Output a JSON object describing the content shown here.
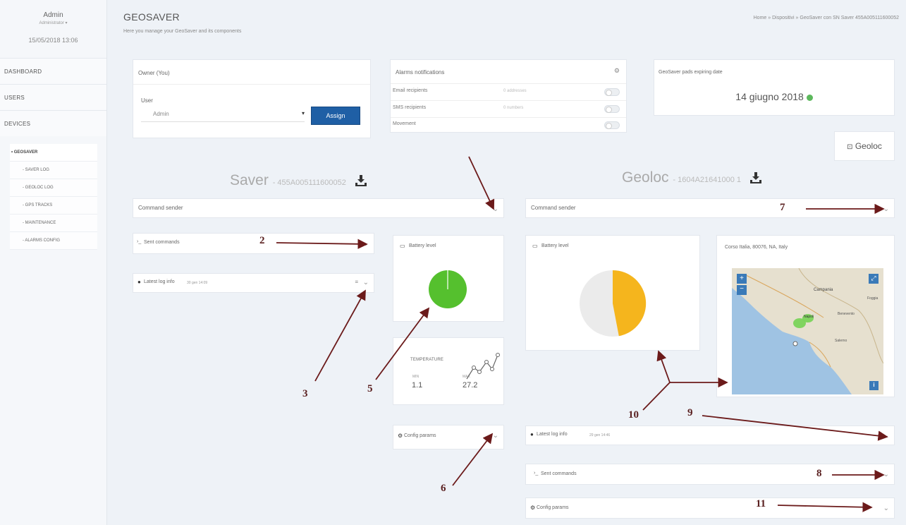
{
  "sidebar": {
    "user_name": "Admin",
    "user_role": "Administrator",
    "date": "15/05/2018 13:06",
    "main_items": [
      "DASHBOARD",
      "USERS",
      "DEVICES"
    ],
    "sub_items": [
      "• GEOSAVER",
      "- SAVER LOG",
      "- GEOLOC LOG",
      "- GPS TRACKS",
      "- MAINTENANCE",
      "- ALARMS CONFIG"
    ]
  },
  "header": {
    "title": "GEOSAVER",
    "subtitle": "Here you manage your GeoSaver and its components",
    "breadcrumb": "Home » Dispositivi » GeoSaver con SN Saver 455A005111600052"
  },
  "owner": {
    "title": "Owner (You)",
    "user_label": "User",
    "user_value": "Admin",
    "assign_label": "Assign"
  },
  "alarms": {
    "title": "Alarms notifications",
    "rows": [
      {
        "label": "Email recipients",
        "value": "0 addresses"
      },
      {
        "label": "SMS recipients",
        "value": "0 numbers"
      },
      {
        "label": "Movement",
        "value": ""
      }
    ]
  },
  "expiry": {
    "title": "GeoSaver pads expiring date",
    "date": "14 giugno 2018",
    "status_color": "#5cb85c"
  },
  "geoloc_button": "Geoloc",
  "saver": {
    "name": "Saver",
    "sn": "- 455A005111600052",
    "command_sender": "Command sender",
    "sent_commands": "Sent commands",
    "latest_log": "Latest log info",
    "latest_log_date": "30 gen 14:09",
    "battery_title": "Battery level",
    "battery_color": "#55c02e",
    "battery_level": 1.0,
    "temperature_title": "TEMPERATURE",
    "temp_min_label": "MIN",
    "temp_min": "1.1",
    "temp_max_label": "MAX",
    "temp_max": "27.2",
    "config_params": "Config params"
  },
  "geoloc": {
    "name": "Geoloc",
    "sn": "- 1604A21641000 1",
    "command_sender": "Command sender",
    "battery_title": "Battery level",
    "battery_color": "#f5b51d",
    "battery_level": 0.47,
    "map_title": "Corso Italia, 80076, NA, Italy",
    "map_labels": [
      "Campania",
      "Benevento",
      "Foggia",
      "Napoli",
      "Salerno"
    ],
    "latest_log": "Latest log info",
    "latest_log_date": "29 gen 14:46",
    "sent_commands": "Sent commands",
    "config_params": "Config params"
  },
  "annotations": [
    "2",
    "3",
    "5",
    "6",
    "7",
    "8",
    "9",
    "10",
    "11"
  ],
  "colors": {
    "assign_button": "#1f5fa5",
    "arrow": "#6b1a1a"
  }
}
